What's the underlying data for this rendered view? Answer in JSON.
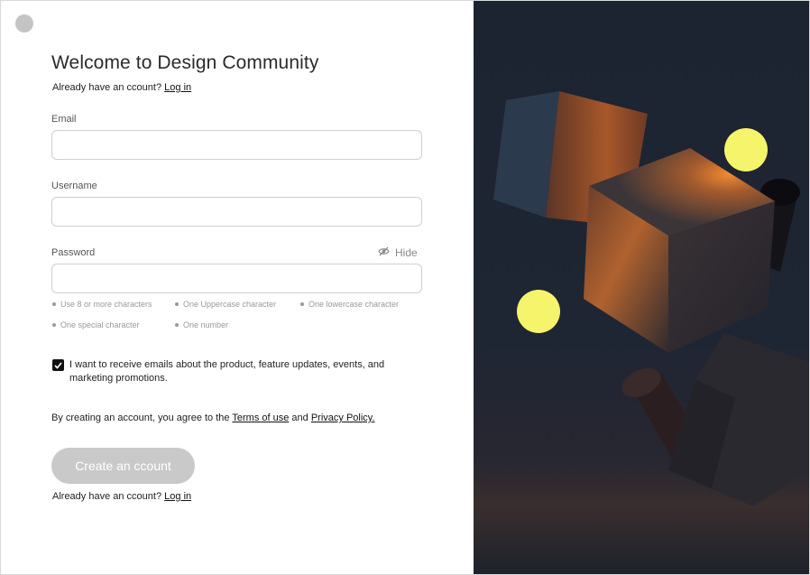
{
  "header": {
    "title": "Welcome to Design Community",
    "login_prompt": "Already have an ccount?",
    "login_link": "Log in"
  },
  "form": {
    "email": {
      "label": "Email",
      "value": "",
      "placeholder": ""
    },
    "username": {
      "label": "Username",
      "value": "",
      "placeholder": ""
    },
    "password": {
      "label": "Password",
      "value": "",
      "placeholder": "",
      "toggle_label": "Hide"
    },
    "password_hints": [
      "Use 8 or more characters",
      "One Uppercase character",
      "One lowercase character",
      "One special character",
      "One number"
    ],
    "marketing_checkbox": {
      "checked": true,
      "label": "I want to receive emails about the product, feature updates, events, and marketing promotions."
    },
    "consent": {
      "prefix": "By creating an account, you agree to the",
      "terms_link": "Terms of use",
      "and": "and",
      "privacy_link": "Privacy Policy."
    },
    "submit_label": "Create an ccount"
  },
  "footer": {
    "login_prompt": "Already have an ccount?",
    "login_link": "Log in"
  },
  "colors": {
    "submit_disabled": "#c9c9c9",
    "accent_yellow": "#f6f46b",
    "panel_dark": "#1c2331",
    "cube_glow": "#e07a2a"
  },
  "icons": {
    "hide_password": "eye-slash-icon",
    "checkbox": "check-icon"
  }
}
